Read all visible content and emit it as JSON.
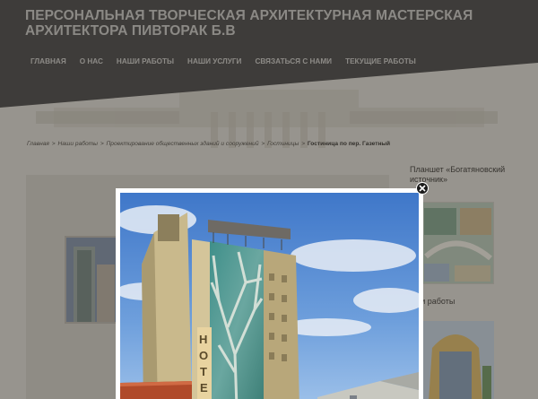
{
  "site": {
    "title": "ПЕРСОНАЛЬНАЯ ТВОРЧЕСКАЯ АРХИТЕКТУРНАЯ МАСТЕРСКАЯ АРХИТЕКТОРА ПИВТОРАК Б.В"
  },
  "nav": {
    "items": [
      {
        "label": "ГЛАВНАЯ"
      },
      {
        "label": "О НАС"
      },
      {
        "label": "НАШИ РАБОТЫ"
      },
      {
        "label": "НАШИ УСЛУГИ"
      },
      {
        "label": "СВЯЗАТЬСЯ С НАМИ"
      },
      {
        "label": "ТЕКУЩИЕ РАБОТЫ"
      }
    ]
  },
  "breadcrumb": {
    "items": [
      {
        "label": "Главная"
      },
      {
        "label": "Наши работы"
      },
      {
        "label": "Проектирование общественных зданий и сооружений"
      },
      {
        "label": "Гостиницы"
      }
    ],
    "separator": ">",
    "current": "Гостиница по пер. Газетный"
  },
  "sidebar": {
    "widget_title": "Планшет «Богатяновский источник»",
    "heading2": "ши работы"
  },
  "lightbox": {
    "sign_text": "HOTE"
  },
  "colors": {
    "header_bg": "#5a5753",
    "header_text": "#c7c4bf",
    "page_bg": "#d9d5cc",
    "lightbox_border": "#ffffff",
    "close_button": "#1b1b1b"
  },
  "icons": {
    "close": "close-icon"
  }
}
